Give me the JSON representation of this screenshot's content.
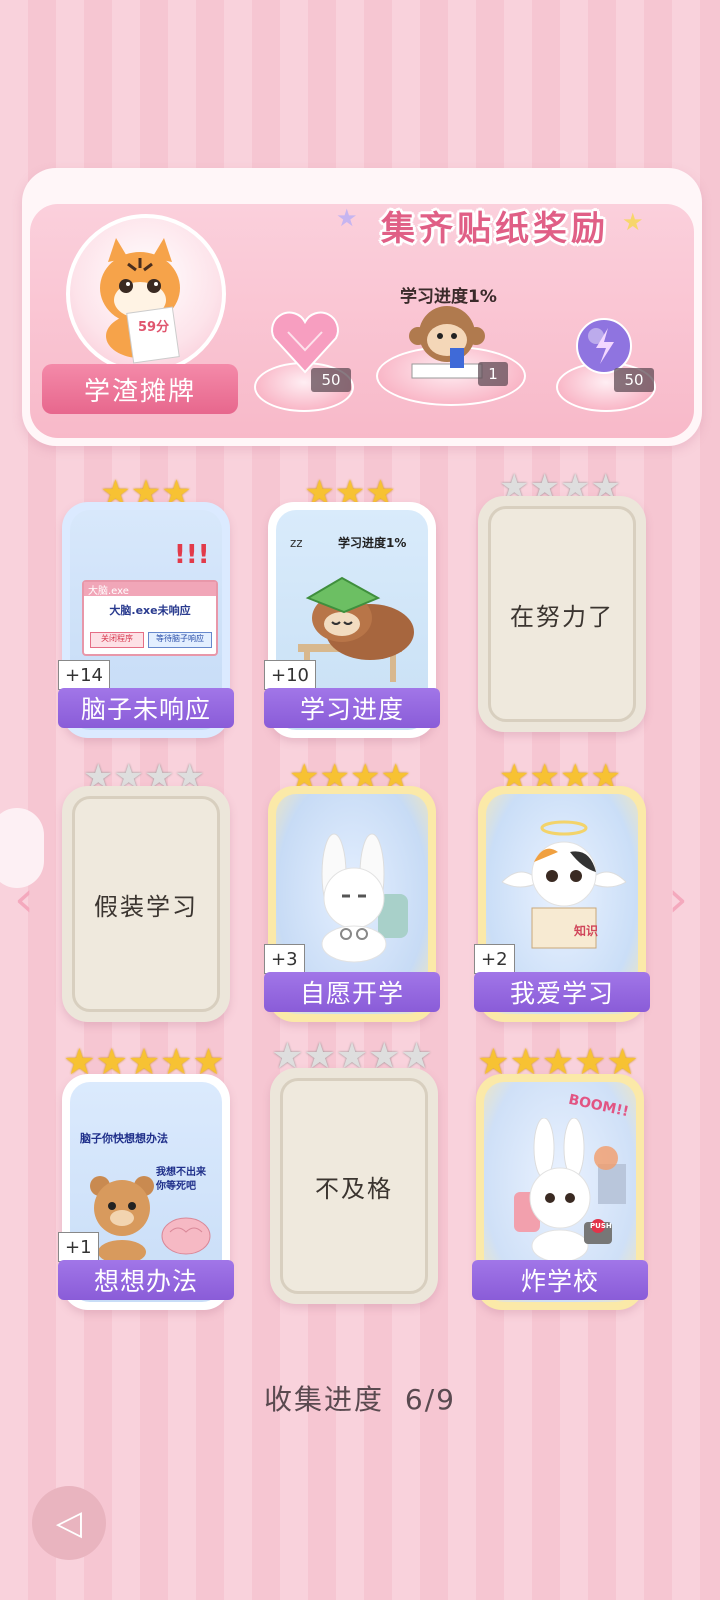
{
  "banner": {
    "title": "集齐贴纸奖励",
    "avatar_ribbon": "学渣摊牌",
    "avatar_paper_score": "59分",
    "progress_caption": "学习进度1%",
    "rewards": [
      {
        "icon": "pink-heart-gem-icon",
        "count": "50"
      },
      {
        "icon": "monkey-reading-icon",
        "count": "1"
      },
      {
        "icon": "purple-lightning-orb-icon",
        "count": "50"
      }
    ]
  },
  "cards": [
    {
      "name": "脑子未响应",
      "plus": "+14",
      "stars": 3,
      "earned": 3,
      "locked": false,
      "art": "brain-not-responding",
      "art_text": {
        "exclaim": "!!!",
        "window_title": "大脑.exe",
        "dialog_text": "大脑.exe未响应",
        "btn_close": "关闭程序",
        "btn_wait": "等待脑子响应"
      }
    },
    {
      "name": "学习进度",
      "plus": "+10",
      "stars": 3,
      "earned": 3,
      "locked": false,
      "art": "sleeping-sloth",
      "art_text": {
        "caption": "学习进度1%",
        "zz": "zz"
      }
    },
    {
      "name": "在努力了",
      "stars": 4,
      "earned": 0,
      "locked": true
    },
    {
      "name": "假装学习",
      "stars": 4,
      "earned": 0,
      "locked": true
    },
    {
      "name": "自愿开学",
      "plus": "+3",
      "stars": 4,
      "earned": 4,
      "locked": false,
      "art": "bunny-handcuffed"
    },
    {
      "name": "我爱学习",
      "plus": "+2",
      "stars": 4,
      "earned": 4,
      "locked": false,
      "art": "angel-cat",
      "art_text": {
        "book": "知识"
      }
    },
    {
      "name": "想想办法",
      "plus": "+1",
      "stars": 5,
      "earned": 5,
      "locked": false,
      "art": "bear-and-brain",
      "art_text": {
        "top": "脑子你快想想办法",
        "bubble": "我想不出来 你等死吧"
      }
    },
    {
      "name": "不及格",
      "stars": 5,
      "earned": 0,
      "locked": true
    },
    {
      "name": "炸学校",
      "stars": 5,
      "earned": 5,
      "locked": false,
      "art": "bunny-boom",
      "art_text": {
        "boom": "BOOM!!",
        "push": "PUSH"
      }
    }
  ],
  "footer": {
    "label": "收集进度",
    "progress": "6/9"
  },
  "colors": {
    "accent": "#e05f86",
    "name_bar": "#9a6ee3",
    "gold_star": "#f7c233",
    "silver_star": "#dedede"
  }
}
